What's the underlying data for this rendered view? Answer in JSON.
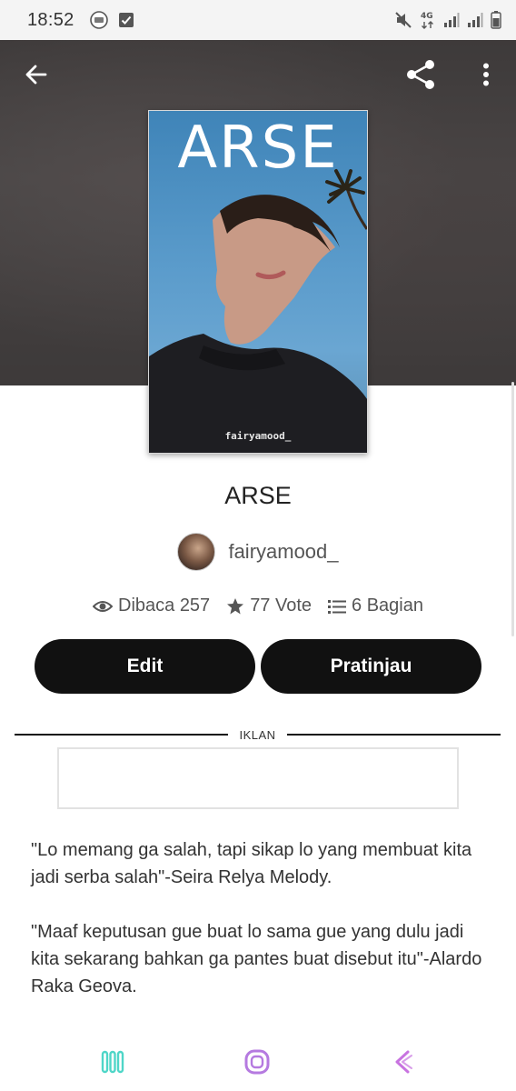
{
  "status_bar": {
    "time": "18:52",
    "left_icons": [
      "app-notification-icon",
      "checkbox-notification-icon"
    ],
    "right_icons": [
      "mute-icon",
      "network-4g-icon",
      "signal-icon",
      "signal-icon-2",
      "battery-icon"
    ],
    "network_label": "4G"
  },
  "header": {
    "back_icon": "arrow-left-icon",
    "share_icon": "share-icon",
    "more_icon": "more-vertical-icon"
  },
  "cover": {
    "title": "ARSE",
    "author_mark": "fairyamood_"
  },
  "story": {
    "title": "ARSE",
    "author": "fairyamood_"
  },
  "stats": {
    "reads": "Dibaca 257",
    "votes": "77 Vote",
    "parts": "6 Bagian"
  },
  "actions": {
    "edit_label": "Edit",
    "preview_label": "Pratinjau"
  },
  "ad": {
    "label": "IKLAN"
  },
  "description": {
    "paragraphs": [
      "\"Lo memang ga salah, tapi sikap lo yang membuat kita jadi serba salah\"-Seira Relya Melody.",
      "\"Maaf keputusan gue buat lo sama gue yang dulu jadi kita sekarang bahkan ga pantes buat disebut itu\"-Alardo Raka Geova."
    ]
  },
  "nav_bar": {
    "recent_icon": "recent-apps-icon",
    "home_icon": "home-icon",
    "back_icon": "back-icon"
  },
  "colors": {
    "button_bg": "#111111",
    "nav_recent": "#4fd6c8",
    "nav_home": "#b57ae0",
    "nav_back": "#c873e0"
  }
}
